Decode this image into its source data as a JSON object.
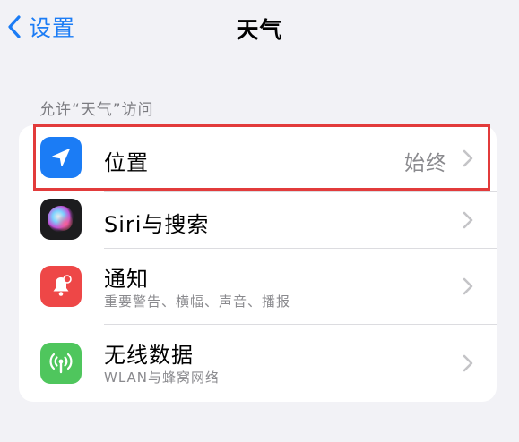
{
  "nav": {
    "back_label": "设置",
    "title": "天气"
  },
  "section_header": "允许“天气”访问",
  "rows": [
    {
      "label": "位置",
      "value": "始终",
      "icon": "location-arrow-icon",
      "icon_color": "#1b7cf5"
    },
    {
      "label": "Siri与搜索",
      "icon": "siri-icon",
      "icon_color": "#1c1c1e"
    },
    {
      "label": "通知",
      "sublabel": "重要警告、横幅、声音、播报",
      "icon": "bell-icon",
      "icon_color": "#ee4747"
    },
    {
      "label": "无线数据",
      "sublabel": "WLAN与蜂窝网络",
      "icon": "antenna-icon",
      "icon_color": "#4fc65d"
    }
  ],
  "colors": {
    "accent": "#1b7cf5",
    "highlight_box": "#e23b3b",
    "background": "#f2f2f6"
  }
}
